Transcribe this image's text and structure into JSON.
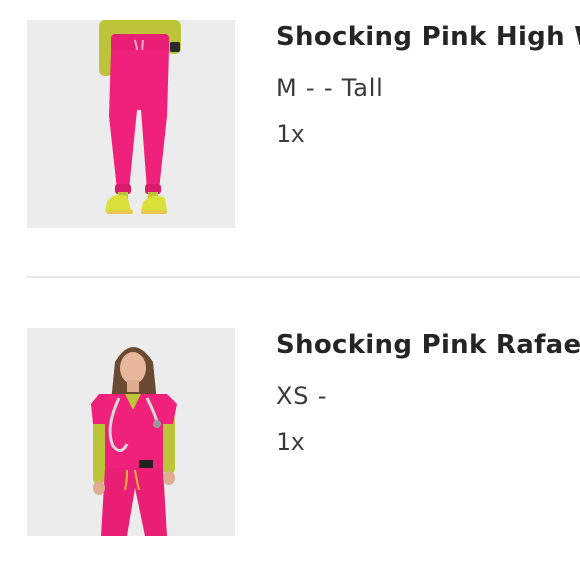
{
  "items": [
    {
      "title": "Shocking Pink High W",
      "variant": "M - - Tall",
      "quantity": "1x",
      "image": "pink-jogger-pants-photo"
    },
    {
      "title": "Shocking Pink Rafae",
      "variant": "XS -",
      "quantity": "1x",
      "image": "pink-scrub-top-photo"
    }
  ],
  "colors": {
    "product_pink": "#f0217a",
    "shirt_lime": "#bcc43a",
    "shoe_yellow": "#d9e03a",
    "photo_background": "#ececec",
    "divider": "#e6e6e6"
  }
}
